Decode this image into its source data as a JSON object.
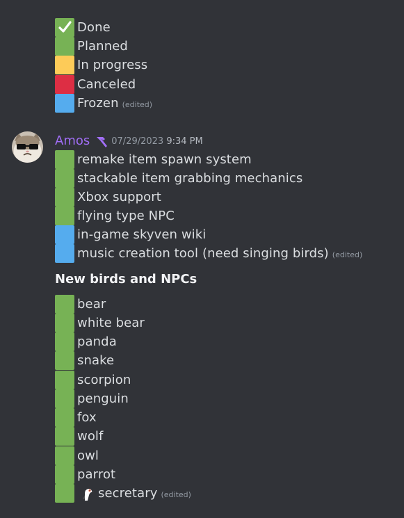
{
  "legend": [
    {
      "color": "#77b255",
      "label": "Done",
      "check": true
    },
    {
      "color": "#77b255",
      "label": "Planned"
    },
    {
      "color": "#fdcb58",
      "label": "In progress"
    },
    {
      "color": "#dd2e44",
      "label": "Canceled"
    },
    {
      "color": "#55acee",
      "label": "Frozen",
      "edited": "(edited)"
    }
  ],
  "message": {
    "username": "Amos",
    "username_color": "#a16ef6",
    "role_icon": "hammer-icon",
    "date": "07/29/2023",
    "time": "9:34 PM",
    "items": [
      {
        "color": "green",
        "label": "remake item spawn system"
      },
      {
        "color": "green",
        "label": "stackable item grabbing mechanics"
      },
      {
        "color": "green",
        "label": "Xbox support"
      },
      {
        "color": "green",
        "label": "flying type NPC"
      },
      {
        "color": "blue",
        "label": "in-game skyven wiki"
      },
      {
        "color": "blue",
        "label": "music creation tool (need singing birds)",
        "edited": "(edited)"
      }
    ],
    "subheading": "New birds and NPCs",
    "birds": [
      {
        "color": "green",
        "label": "bear"
      },
      {
        "color": "green",
        "label": "white bear"
      },
      {
        "color": "green",
        "label": "panda"
      },
      {
        "color": "green",
        "label": "snake"
      },
      {
        "color": "green",
        "label": "scorpion"
      },
      {
        "color": "green",
        "label": "penguin"
      },
      {
        "color": "green",
        "label": "fox"
      },
      {
        "color": "green",
        "label": "wolf"
      },
      {
        "color": "green",
        "label": "owl"
      },
      {
        "color": "green",
        "label": "parrot"
      },
      {
        "color": "green",
        "label": "secretary",
        "emoji": "secretary-bird-emoji",
        "edited": "(edited)"
      }
    ]
  }
}
